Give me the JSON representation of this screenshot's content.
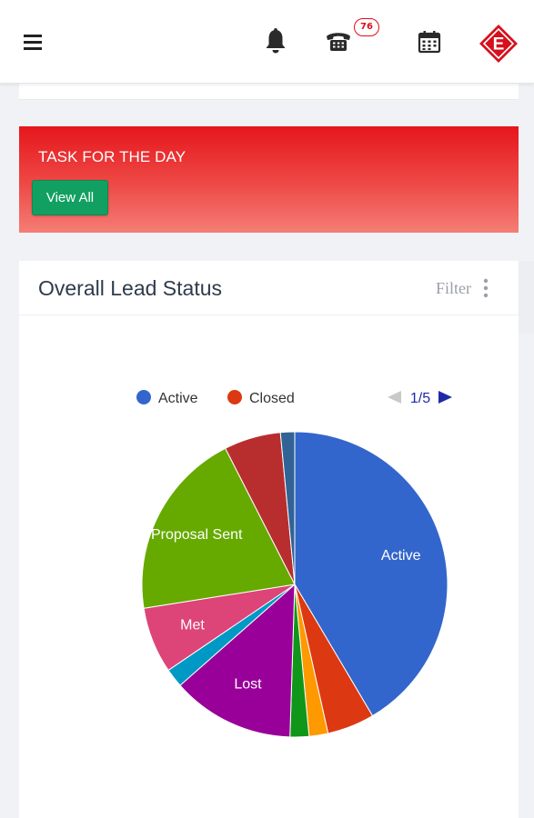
{
  "header": {
    "notification_badge": "76",
    "icons": [
      "menu-icon",
      "bell-icon",
      "phone-icon",
      "calendar-icon",
      "logo"
    ],
    "logo_letter": "E",
    "logo_color": "#d6101c"
  },
  "task_banner": {
    "title": "TASK FOR THE DAY",
    "view_all_label": "View All",
    "color": "#e6161c",
    "button_color": "#11a061"
  },
  "lead_card": {
    "title": "Overall Lead Status",
    "filter_label": "Filter"
  },
  "chart_data": {
    "type": "pie",
    "title": "",
    "legend": {
      "visible_items": [
        {
          "label": "Active",
          "color": "#3366cc"
        },
        {
          "label": "Closed",
          "color": "#dc3912"
        }
      ],
      "page": "1/5",
      "placement": "top"
    },
    "slices": [
      {
        "label": "Active",
        "value": 41.5,
        "color": "#3366cc",
        "show_label": true
      },
      {
        "label": "Closed",
        "value": 5.0,
        "color": "#dc3912",
        "show_label": false
      },
      {
        "label": "",
        "value": 2.0,
        "color": "#ff9900",
        "show_label": false
      },
      {
        "label": "",
        "value": 2.0,
        "color": "#109618",
        "show_label": false
      },
      {
        "label": "Lost",
        "value": 13.0,
        "color": "#990099",
        "show_label": true
      },
      {
        "label": "",
        "value": 2.0,
        "color": "#0099c6",
        "show_label": false
      },
      {
        "label": "Met",
        "value": 7.0,
        "color": "#dd4477",
        "show_label": true
      },
      {
        "label": "Proposal Sent",
        "value": 20.0,
        "color": "#66aa00",
        "show_label": true
      },
      {
        "label": "",
        "value": 6.0,
        "color": "#b82e2e",
        "show_label": false
      },
      {
        "label": "",
        "value": 1.5,
        "color": "#316395",
        "show_label": false
      }
    ]
  }
}
